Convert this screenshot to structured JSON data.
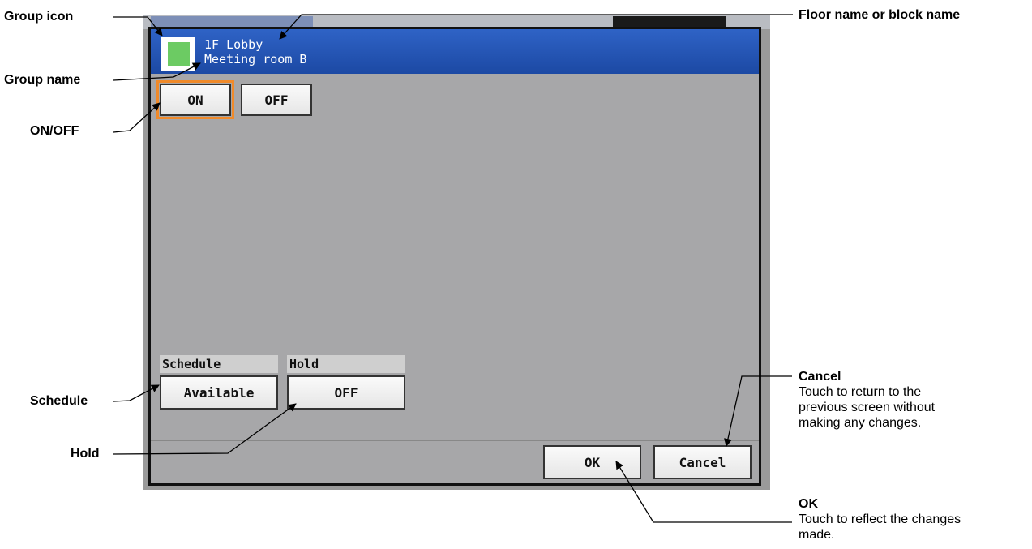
{
  "callouts": {
    "group_icon": "Group icon",
    "floor_name": "Floor name or block name",
    "group_name": "Group name",
    "on_off": "ON/OFF",
    "schedule": "Schedule",
    "hold": "Hold",
    "cancel_title": "Cancel",
    "cancel_desc_1": "Touch to return to the",
    "cancel_desc_2": "previous screen without",
    "cancel_desc_3": "making any changes.",
    "ok_title": "OK",
    "ok_desc_1": "Touch to reflect the changes",
    "ok_desc_2": "made."
  },
  "dialog": {
    "floor_name": "1F Lobby",
    "group_name": "Meeting room B",
    "on_label": "ON",
    "off_label": "OFF",
    "selected": "ON",
    "schedule_label": "Schedule",
    "schedule_value": "Available",
    "hold_label": "Hold",
    "hold_value": "OFF",
    "ok_label": "OK",
    "cancel_label": "Cancel"
  },
  "colors": {
    "title_bar": "#1c49a4",
    "group_icon": "#6ccb63",
    "selected_outline": "#f08a2a",
    "dialog_bg": "#a7a7a9"
  }
}
